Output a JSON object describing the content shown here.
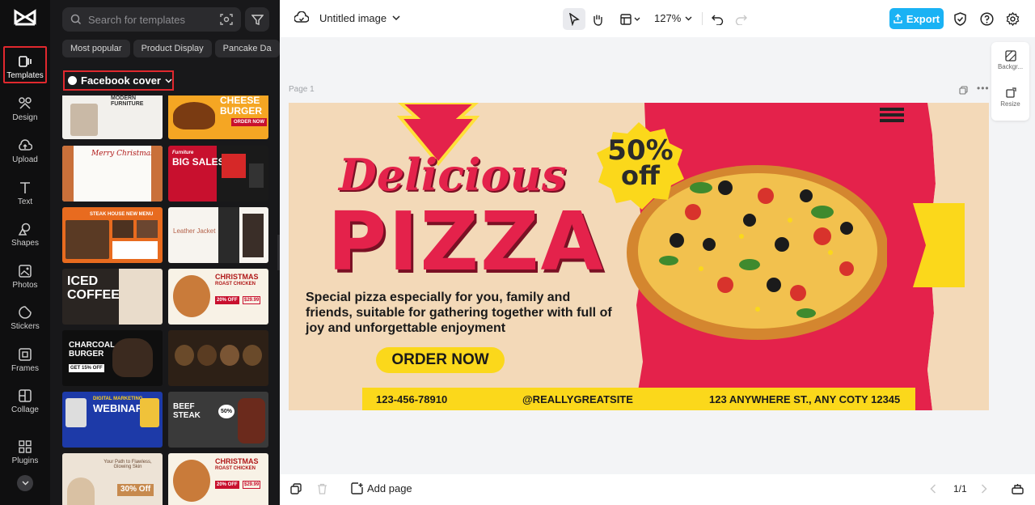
{
  "rail": {
    "items": [
      {
        "label": "Templates"
      },
      {
        "label": "Design"
      },
      {
        "label": "Upload"
      },
      {
        "label": "Text"
      },
      {
        "label": "Shapes"
      },
      {
        "label": "Photos"
      },
      {
        "label": "Stickers"
      },
      {
        "label": "Frames"
      },
      {
        "label": "Collage"
      },
      {
        "label": "Plugins"
      }
    ]
  },
  "panel": {
    "search_placeholder": "Search for templates",
    "chips": [
      "Most popular",
      "Product Display",
      "Pancake Da"
    ],
    "category": "Facebook cover",
    "thumbs": {
      "t1": "MODERN FURNITURE",
      "t2": "CHEESE BURGER",
      "t2b": "ORDER NOW",
      "t3": "Merry Christmas",
      "t4a": "Furniture",
      "t4": "BIG SALES",
      "t5": "STEAK HOUSE NEW MENU",
      "t6": "Leather Jacket",
      "t7": "ICED COFFEE",
      "t8": "CHRISTMAS",
      "t8b": "ROAST CHICKEN",
      "t8c": "20% OFF",
      "t8d": "$29.99",
      "t9": "CHARCOAL BURGER",
      "t9b": "GET 15% OFF",
      "t11a": "DIGITAL MARKETING",
      "t11": "WEBINAR",
      "t12": "BEEF STEAK",
      "t12b": "50%",
      "t13": "Your Path to Flawless, Glowing Skin",
      "t13b": "30% Off",
      "t14": "CHRISTMAS",
      "t14b": "ROAST CHICKEN",
      "t14c": "20% OFF",
      "t14d": "$29.99"
    }
  },
  "topbar": {
    "doc_title": "Untitled image",
    "zoom": "127%",
    "export_label": "Export"
  },
  "stage": {
    "page_label": "Page 1",
    "side": {
      "background": "Backgr...",
      "resize": "Resize"
    }
  },
  "design": {
    "discount_line1": "50%",
    "discount_line2": "off",
    "script_word": "Delicious",
    "headline": "PIZZA",
    "body": "Special pizza especially for you, family and friends, suitable for gathering together with full of joy and unforgettable enjoyment",
    "cta": "ORDER NOW",
    "phone": "123-456-78910",
    "site": "@REALLYGREATSITE",
    "address": "123 ANYWHERE ST., ANY COTY 12345"
  },
  "bottombar": {
    "add_page": "Add page",
    "page_count": "1/1"
  },
  "colors": {
    "accent": "#1ab2f4",
    "highlight": "#e0282e",
    "pizza_red": "#e4224b",
    "yellow": "#fbd81b"
  }
}
